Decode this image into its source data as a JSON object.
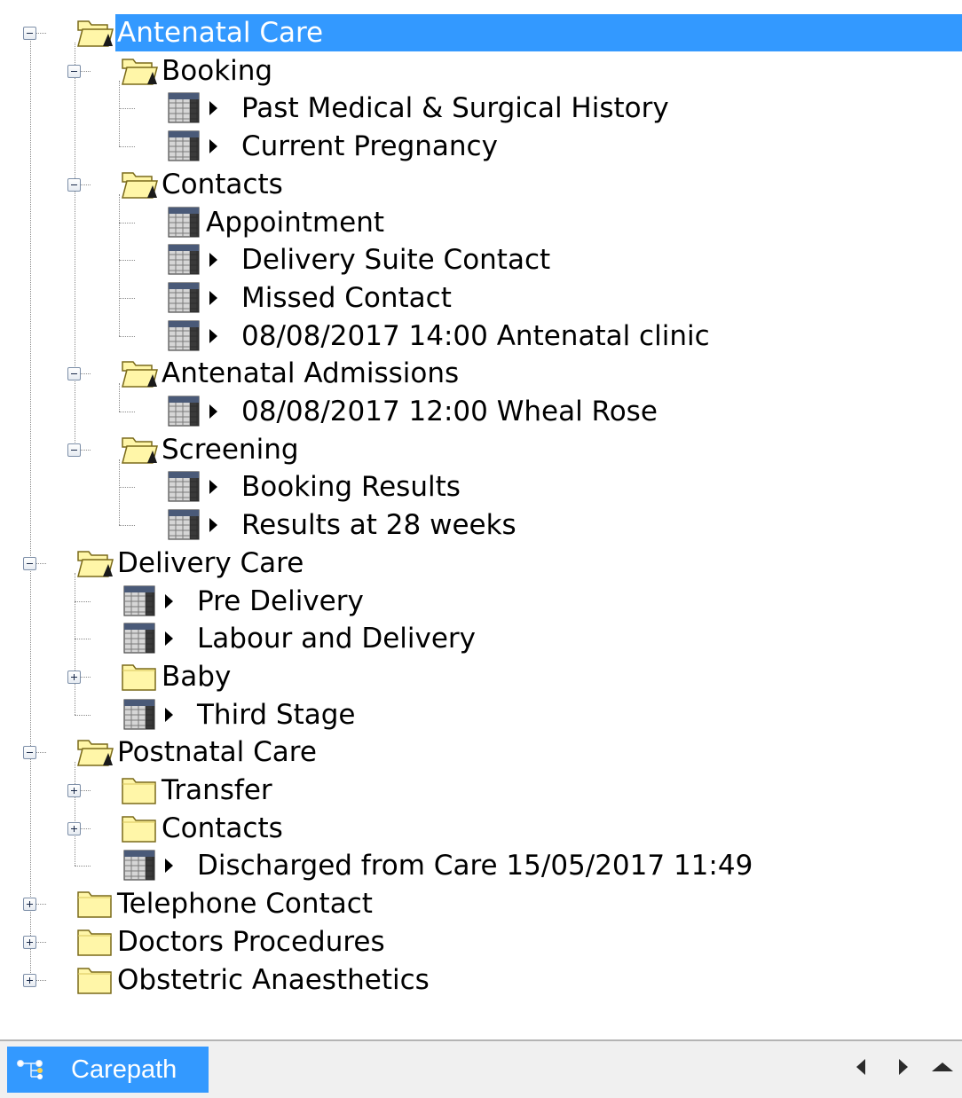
{
  "tree": {
    "nodes": [
      {
        "label": "Antenatal Care",
        "depth": 0,
        "kind": "folder",
        "expander": "minus",
        "open": true,
        "selected": true,
        "arrow": false
      },
      {
        "label": "Booking",
        "depth": 1,
        "kind": "folder",
        "expander": "minus",
        "open": true,
        "selected": false,
        "arrow": false
      },
      {
        "label": "Past Medical & Surgical History",
        "depth": 2,
        "kind": "form",
        "expander": "none",
        "selected": false,
        "arrow": true
      },
      {
        "label": "Current Pregnancy",
        "depth": 2,
        "kind": "form",
        "expander": "none",
        "selected": false,
        "arrow": true
      },
      {
        "label": "Contacts",
        "depth": 1,
        "kind": "folder",
        "expander": "minus",
        "open": true,
        "selected": false,
        "arrow": false
      },
      {
        "label": "Appointment",
        "depth": 2,
        "kind": "form",
        "expander": "none",
        "selected": false,
        "arrow": false
      },
      {
        "label": "Delivery Suite Contact",
        "depth": 2,
        "kind": "form",
        "expander": "none",
        "selected": false,
        "arrow": true
      },
      {
        "label": "Missed Contact",
        "depth": 2,
        "kind": "form",
        "expander": "none",
        "selected": false,
        "arrow": true
      },
      {
        "label": "08/08/2017 14:00 Antenatal clinic",
        "depth": 2,
        "kind": "form",
        "expander": "none",
        "selected": false,
        "arrow": true
      },
      {
        "label": "Antenatal Admissions",
        "depth": 1,
        "kind": "folder",
        "expander": "minus",
        "open": true,
        "selected": false,
        "arrow": false
      },
      {
        "label": "08/08/2017 12:00 Wheal Rose",
        "depth": 2,
        "kind": "form",
        "expander": "none",
        "selected": false,
        "arrow": true
      },
      {
        "label": "Screening",
        "depth": 1,
        "kind": "folder",
        "expander": "minus",
        "open": true,
        "selected": false,
        "arrow": false
      },
      {
        "label": "Booking Results",
        "depth": 2,
        "kind": "form",
        "expander": "none",
        "selected": false,
        "arrow": true
      },
      {
        "label": "Results at 28 weeks",
        "depth": 2,
        "kind": "form",
        "expander": "none",
        "selected": false,
        "arrow": true
      },
      {
        "label": "Delivery Care",
        "depth": 0,
        "kind": "folder",
        "expander": "minus",
        "open": true,
        "selected": false,
        "arrow": false
      },
      {
        "label": "Pre Delivery",
        "depth": 1,
        "kind": "form",
        "expander": "none",
        "selected": false,
        "arrow": true
      },
      {
        "label": "Labour and Delivery",
        "depth": 1,
        "kind": "form",
        "expander": "none",
        "selected": false,
        "arrow": true
      },
      {
        "label": "Baby",
        "depth": 1,
        "kind": "folder",
        "expander": "plus",
        "open": false,
        "selected": false,
        "arrow": false
      },
      {
        "label": "Third Stage",
        "depth": 1,
        "kind": "form",
        "expander": "none",
        "selected": false,
        "arrow": true
      },
      {
        "label": "Postnatal Care",
        "depth": 0,
        "kind": "folder",
        "expander": "minus",
        "open": true,
        "selected": false,
        "arrow": false
      },
      {
        "label": "Transfer",
        "depth": 1,
        "kind": "folder",
        "expander": "plus",
        "open": false,
        "selected": false,
        "arrow": false
      },
      {
        "label": "Contacts",
        "depth": 1,
        "kind": "folder",
        "expander": "plus",
        "open": false,
        "selected": false,
        "arrow": false
      },
      {
        "label": "Discharged from Care 15/05/2017 11:49",
        "depth": 1,
        "kind": "form",
        "expander": "none",
        "selected": false,
        "arrow": true
      },
      {
        "label": "Telephone Contact",
        "depth": 0,
        "kind": "folder",
        "expander": "plus",
        "open": false,
        "selected": false,
        "arrow": false
      },
      {
        "label": "Doctors Procedures",
        "depth": 0,
        "kind": "folder",
        "expander": "plus",
        "open": false,
        "selected": false,
        "arrow": false
      },
      {
        "label": "Obstetric Anaesthetics",
        "depth": 0,
        "kind": "folder",
        "expander": "plus",
        "open": false,
        "selected": false,
        "arrow": false
      }
    ]
  },
  "bottom_bar": {
    "tab_label": "Carepath",
    "tab_icon": "carepath-tree-icon",
    "nav_icons": [
      "scroll-left-icon",
      "scroll-right-icon",
      "scroll-up-icon"
    ]
  },
  "colors": {
    "selection": "#3399ff",
    "folder": "#fff6a8",
    "form_icon": "#4a5a78"
  }
}
